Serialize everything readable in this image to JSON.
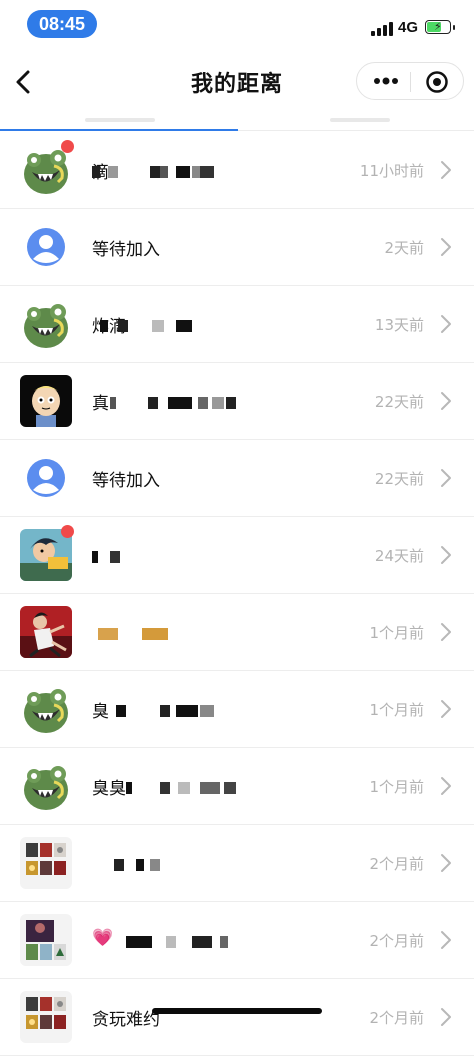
{
  "status": {
    "time": "08:45",
    "network": "4G"
  },
  "nav": {
    "title": "我的距离"
  },
  "rows": [
    {
      "name": "滴",
      "time": "11小时前",
      "badge": true,
      "avatar": "monster"
    },
    {
      "name": "等待加入",
      "time": "2天前",
      "badge": false,
      "avatar": "placeholder"
    },
    {
      "name": "炸滴",
      "time": "13天前",
      "badge": false,
      "avatar": "monster"
    },
    {
      "name": "真",
      "time": "22天前",
      "badge": false,
      "avatar": "cartoon-boy"
    },
    {
      "name": "等待加入",
      "time": "22天前",
      "badge": false,
      "avatar": "placeholder"
    },
    {
      "name": "",
      "time": "24天前",
      "badge": true,
      "avatar": "anime-boy"
    },
    {
      "name": "",
      "time": "1个月前",
      "badge": false,
      "avatar": "dancer"
    },
    {
      "name": "臭",
      "time": "1个月前",
      "badge": false,
      "avatar": "monster"
    },
    {
      "name": "臭臭",
      "time": "1个月前",
      "badge": false,
      "avatar": "monster"
    },
    {
      "name": "",
      "time": "2个月前",
      "badge": false,
      "avatar": "grid"
    },
    {
      "name": "💗",
      "time": "2个月前",
      "badge": false,
      "avatar": "grid2"
    },
    {
      "name": "贪玩难约",
      "time": "2个月前",
      "badge": false,
      "avatar": "grid"
    }
  ],
  "colors": {
    "accent": "#2f7be8",
    "badge": "#f04a4a",
    "placeholder": "#5b8def",
    "time": "#b3b3b3"
  },
  "icons": {
    "back": "chevron-left-icon",
    "more": "more-dots-icon",
    "close": "target-close-icon",
    "row": "chevron-right-icon"
  }
}
